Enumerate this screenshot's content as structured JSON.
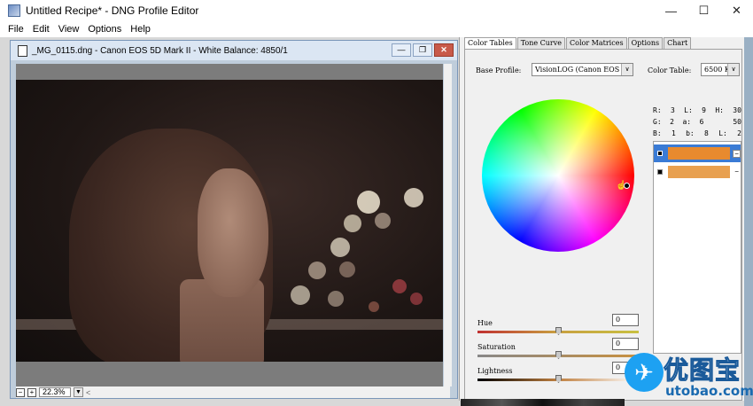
{
  "window": {
    "title": "Untitled Recipe* - DNG Profile Editor",
    "minimize": "—",
    "maximize": "☐",
    "close": "✕"
  },
  "menu": [
    "File",
    "Edit",
    "View",
    "Options",
    "Help"
  ],
  "image_window": {
    "title": "_MG_0115.dng  - Canon EOS 5D Mark II - White Balance: 4850/1",
    "minimize": "—",
    "restore": "❐",
    "close": "✕",
    "zoom_out": "−",
    "zoom_in": "+",
    "zoom_value": "22.3%",
    "dropdown": "▼",
    "scroll_left": "<"
  },
  "tabs": [
    "Color Tables",
    "Tone Curve",
    "Color Matrices",
    "Options",
    "Chart"
  ],
  "color_tables": {
    "base_profile_label": "Base Profile:",
    "base_profile_value": "VisionLOG (Canon EOS",
    "color_table_label": "Color Table:",
    "color_table_value": "6500 K",
    "combo_arrow": "∨",
    "readout": [
      [
        "R:",
        "3",
        "L:",
        "9",
        "H:",
        "30"
      ],
      [
        "G:",
        "2",
        "a:",
        "6",
        "",
        "50"
      ],
      [
        "B:",
        "1",
        "b:",
        "8",
        "L:",
        "2"
      ]
    ],
    "swatches": [
      {
        "color": "#e88a2e",
        "selected": true,
        "minus": "−"
      },
      {
        "color": "#e8a050",
        "selected": false,
        "minus": "−"
      }
    ],
    "sliders": [
      {
        "label": "Hue",
        "value": "0",
        "track": "linear-gradient(90deg,#c03030,#c8a040,#c8c040)"
      },
      {
        "label": "Saturation",
        "value": "0",
        "track": "linear-gradient(90deg,#888888,#c89040)"
      },
      {
        "label": "Lightness",
        "value": "0",
        "track": "linear-gradient(90deg,#000000,#c08040,#ffffff)"
      }
    ]
  },
  "watermark": {
    "cn": "优图宝",
    "en": "utobao.com",
    "bird": "✈"
  }
}
